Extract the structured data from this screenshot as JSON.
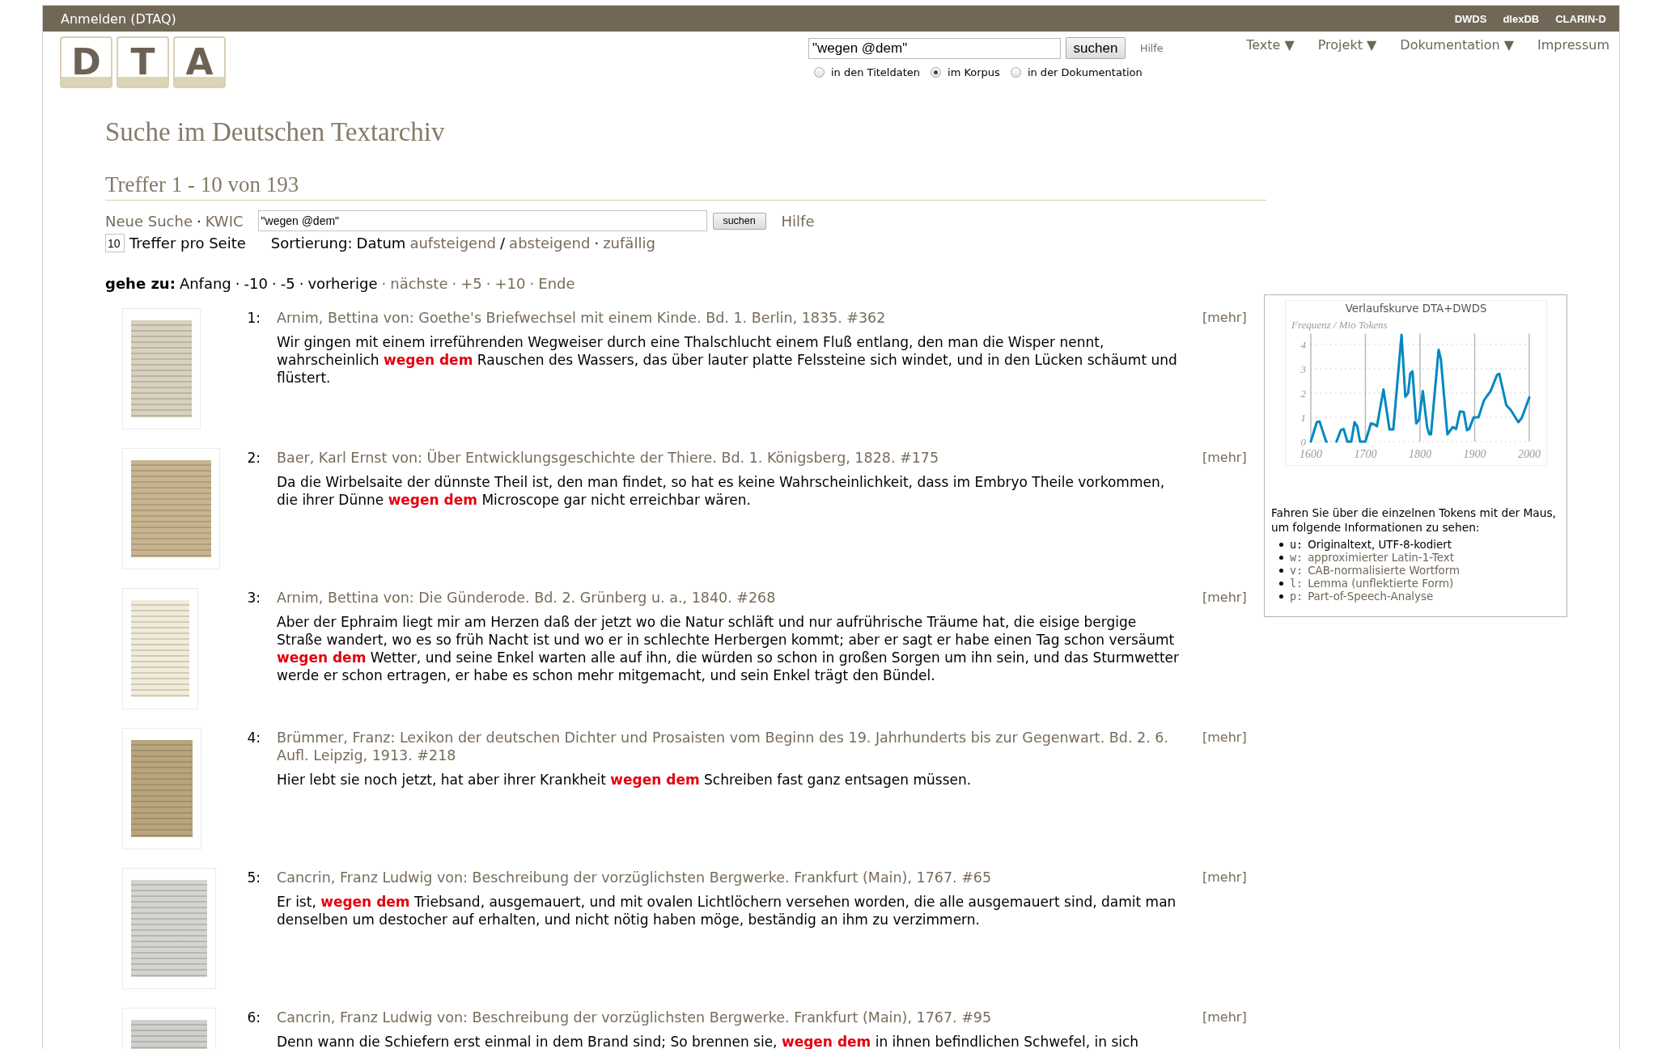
{
  "top_bar": {
    "login": "Anmelden (DTAQ)",
    "links": [
      "DWDS",
      "dlexDB",
      "CLARIN-D"
    ]
  },
  "logo": {
    "letters": [
      "D",
      "T",
      "A"
    ]
  },
  "quick_search": {
    "value": "\"wegen @dem\"",
    "button": "suchen",
    "help": "Hilfe",
    "scopes": [
      {
        "label": "in den Titeldaten",
        "selected": false
      },
      {
        "label": "im Korpus",
        "selected": true
      },
      {
        "label": "in der Dokumentation",
        "selected": false
      }
    ]
  },
  "nav": [
    "Texte ▼",
    "Projekt ▼",
    "Dokumentation ▼",
    "Impressum"
  ],
  "page_title": "Suche im Deutschen Textarchiv",
  "hits_heading": "Treffer 1 - 10 von 193",
  "search_form": {
    "links": [
      {
        "text": "Neue Suche"
      },
      {
        "sep": "·",
        "text": "KWIC"
      }
    ],
    "value": "\"wegen @dem\"",
    "button": "suchen",
    "help": "Hilfe",
    "per_page": "10",
    "per_page_label": "Treffer pro Seite",
    "sort_label": "Sortierung:",
    "sort": [
      {
        "text": "Datum",
        "selected": true
      },
      {
        "text": "aufsteigend",
        "selected": false
      },
      {
        "sep": "/",
        "text": "absteigend",
        "selected": false
      },
      {
        "sep": "·",
        "text": "zufällig",
        "selected": false
      }
    ]
  },
  "goto": {
    "label": "gehe zu:",
    "items": [
      {
        "text": "Anfang",
        "disabled": true
      },
      {
        "sep": "·",
        "text": "-10",
        "disabled": true
      },
      {
        "sep": "·",
        "text": "-5",
        "disabled": true
      },
      {
        "sep": "·",
        "text": "vorherige",
        "disabled": true
      },
      {
        "sep": "·",
        "text": "nächste",
        "disabled": false
      },
      {
        "sep": "·",
        "text": "+5",
        "disabled": false
      },
      {
        "sep": "·",
        "text": "+10",
        "disabled": false
      },
      {
        "sep": "·",
        "text": "Ende",
        "disabled": false
      }
    ]
  },
  "results": [
    {
      "number": "1:",
      "citation": "Arnim, Bettina von: Goethe's Briefwechsel mit einem Kinde. Bd. 1. Berlin, 1835. #362",
      "snippet": "Wir gingen mit einem irreführenden Wegweiser durch eine Thalschlucht einem Fluß entlang, den man die Wisper nennt, wahrscheinlich **wegen dem** Rauschen des Wassers, das über lauter platte Felssteine sich windet, und in den Lücken schäumt und flüstert.",
      "more": "[mehr]"
    },
    {
      "number": "2:",
      "citation": "Baer, Karl Ernst von: Über Entwicklungsgeschichte der Thiere. Bd. 1. Königsberg, 1828. #175",
      "snippet": "Da die Wirbelsaite der dünnste Theil ist, den man findet, so hat es keine Wahrscheinlichkeit, dass im Embryo Theile vorkommen, die ihrer Dünne **wegen dem** Microscope gar nicht erreichbar wären.",
      "more": "[mehr]"
    },
    {
      "number": "3:",
      "citation": "Arnim, Bettina von: Die Günderode. Bd. 2. Grünberg u. a., 1840. #268",
      "snippet": "Aber der Ephraim liegt mir am Herzen daß der jetzt wo die Natur schläft und nur aufrührische Träume hat, die eisige bergige Straße wandert, wo es so früh Nacht ist und wo er in schlechte Herbergen kommt; aber er sagt er habe einen Tag schon versäumt **wegen dem** Wetter, und seine Enkel warten alle auf ihn, die würden so schon in großen Sorgen um ihn sein, und das Sturmwetter werde er schon ertragen, er habe es schon mehr mitgemacht, und sein Enkel trägt den Bündel.",
      "more": "[mehr]"
    },
    {
      "number": "4:",
      "citation": "Brümmer, Franz: Lexikon der deutschen Dichter und Prosaisten vom Beginn des 19. Jahrhunderts bis zur Gegenwart. Bd. 2. 6. Aufl. Leipzig, 1913. #218",
      "snippet": "Hier lebt sie noch jetzt, hat aber ihrer Krankheit **wegen dem** Schreiben fast ganz entsagen müssen.",
      "more": "[mehr]"
    },
    {
      "number": "5:",
      "citation": "Cancrin, Franz Ludwig von: Beschreibung der vorzüglichsten Bergwerke. Frankfurt (Main), 1767. #65",
      "snippet": "Er ist, **wegen dem** Triebsand, ausgemauert, und mit ovalen Lichtlöchern versehen worden, die alle ausgemauert sind, damit man denselben um destocher auf erhalten, und nicht nötig haben möge, beständig an ihm zu verzimmern.",
      "more": "[mehr]"
    },
    {
      "number": "6:",
      "citation": "Cancrin, Franz Ludwig von: Beschreibung der vorzüglichsten Bergwerke. Frankfurt (Main), 1767. #95",
      "snippet": "Denn wann die Schiefern erst einmal in dem Brand sind; So brennen sie, **wegen dem** in ihnen befindlichen Schwefel, in sich",
      "more": "[mehr]"
    }
  ],
  "side_panel": {
    "chart_data": {
      "type": "line",
      "title": "Verlaufskurve DTA+DWDS",
      "ylabel": "Frequenz / Mio Tokens",
      "x": [
        1600,
        1611,
        1616,
        1628,
        1629,
        1647,
        1655,
        1660,
        1667,
        1674,
        1680,
        1685,
        1690,
        1700,
        1710,
        1717,
        1721,
        1733,
        1744,
        1751,
        1766,
        1773,
        1778,
        1782,
        1786,
        1793,
        1798,
        1805,
        1813,
        1817,
        1820,
        1834,
        1838,
        1850,
        1860,
        1866,
        1873,
        1880,
        1886,
        1890,
        1898,
        1907,
        1917,
        1929,
        1941,
        1945,
        1958,
        1966,
        1980,
        1986,
        2000
      ],
      "series": [
        {
          "color": "#0088c0",
          "values": [
            0,
            0.8,
            0.83,
            0,
            null,
            0,
            0.47,
            0.52,
            0,
            0,
            0.8,
            0.63,
            0,
            0,
            0.75,
            0.7,
            0.63,
            2.15,
            0.5,
            0.5,
            4.4,
            1.85,
            2.0,
            2.8,
            2.9,
            0.75,
            0.9,
            2.08,
            0.58,
            0.3,
            0.3,
            3.78,
            3.4,
            0.3,
            0.6,
            0.52,
            1.24,
            1.22,
            0.47,
            0.52,
            1.0,
            1.0,
            1.7,
            2.08,
            2.75,
            2.8,
            1.5,
            1.3,
            0.8,
            0.97,
            1.82
          ]
        }
      ],
      "xlim": [
        1600,
        2000
      ],
      "ylim": [
        0,
        4.45
      ],
      "xticks": [
        1600,
        1700,
        1800,
        1900,
        2000
      ],
      "yticks": [
        0,
        1,
        2,
        3,
        4
      ],
      "grid": true
    },
    "info": "Fahren Sie über die einzelnen Tokens mit der Maus, um folgende Informationen zu sehen:",
    "legend": [
      {
        "key": "u:",
        "label": "Originaltext, UTF-8-kodiert",
        "selected": true
      },
      {
        "key": "w:",
        "label": "approximierter Latin-1-Text",
        "selected": false
      },
      {
        "key": "v:",
        "label": "CAB-normalisierte Wortform",
        "selected": false
      },
      {
        "key": "l:",
        "label": "Lemma (unflektierte Form)",
        "selected": false
      },
      {
        "key": "p:",
        "label": "Part-of-Speech-Analyse",
        "selected": false
      }
    ]
  }
}
